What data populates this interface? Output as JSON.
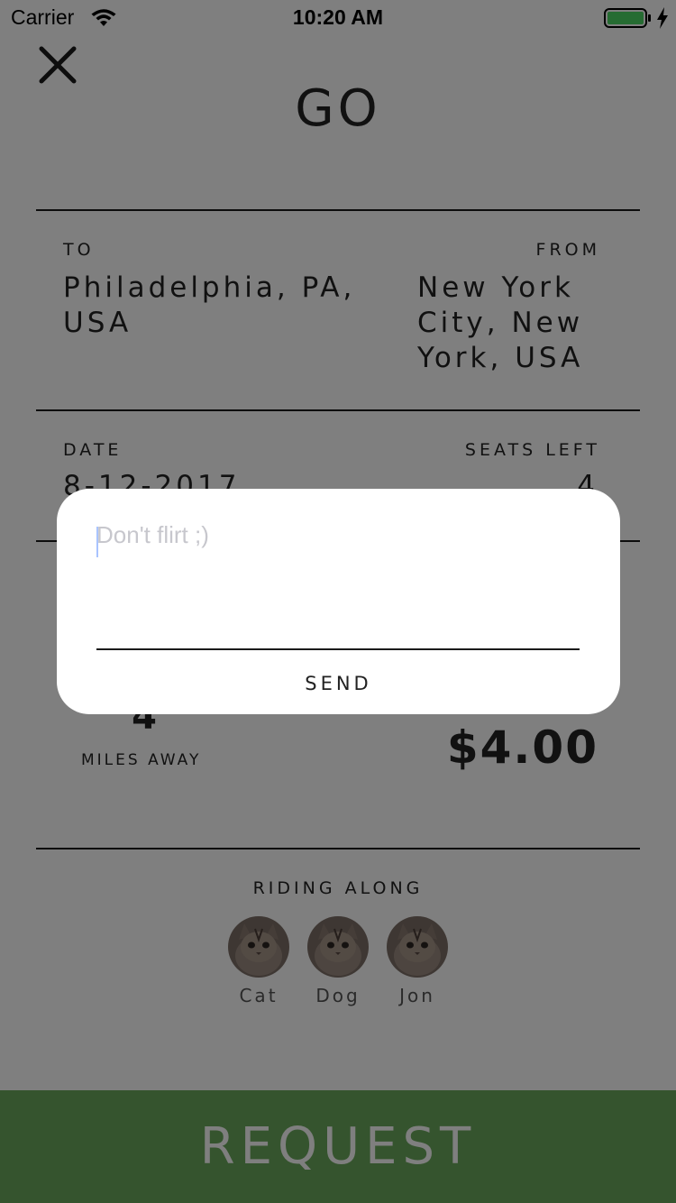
{
  "status_bar": {
    "carrier": "Carrier",
    "time": "10:20 AM",
    "battery_color": "#4cd964"
  },
  "header": {
    "title": "GO",
    "close_icon": "close-icon"
  },
  "route": {
    "to_label": "TO",
    "to_value": "Philadelphia, PA, USA",
    "from_label": "FROM",
    "from_value": "New York City, New York, USA"
  },
  "details": {
    "date_label": "DATE",
    "date_value": "8-12-2017",
    "seats_label": "SEATS LEFT",
    "seats_value": "4"
  },
  "trip": {
    "distance_value": "4",
    "distance_label": "MILES AWAY",
    "price": "$4.00"
  },
  "riders": {
    "label": "RIDING ALONG",
    "items": [
      {
        "name": "Cat"
      },
      {
        "name": "Dog"
      },
      {
        "name": "Jon"
      }
    ]
  },
  "request_button": {
    "label": "REQUEST",
    "color": "#6aa85c"
  },
  "modal": {
    "placeholder": "Don't flirt ;)",
    "send_label": "SEND"
  }
}
